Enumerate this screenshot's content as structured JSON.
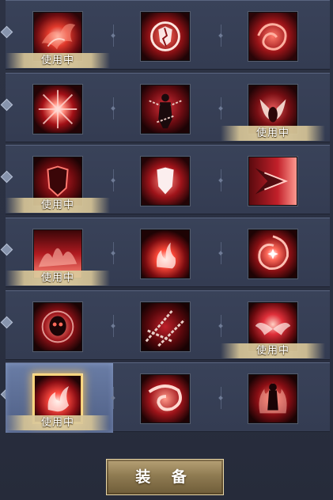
{
  "equip_button": {
    "label": "装 备"
  },
  "badge_text": "使用中",
  "rows": [
    {
      "skills": [
        {
          "name": "flame-burst-skill-icon",
          "in_use": true
        },
        {
          "name": "shattered-shield-skill-icon",
          "in_use": false
        },
        {
          "name": "crimson-swirl-skill-icon",
          "in_use": false
        }
      ]
    },
    {
      "skills": [
        {
          "name": "radiant-explosion-skill-icon",
          "in_use": false
        },
        {
          "name": "chained-figure-skill-icon",
          "in_use": false
        },
        {
          "name": "demon-horns-skill-icon",
          "in_use": true
        }
      ]
    },
    {
      "skills": [
        {
          "name": "blood-shield-skill-icon",
          "in_use": true
        },
        {
          "name": "white-shield-skill-icon",
          "in_use": false
        },
        {
          "name": "dash-streak-skill-icon",
          "in_use": false
        }
      ]
    },
    {
      "skills": [
        {
          "name": "fire-wave-skill-icon",
          "in_use": true
        },
        {
          "name": "blaze-skill-icon",
          "in_use": false
        },
        {
          "name": "vortex-star-skill-icon",
          "in_use": false
        }
      ]
    },
    {
      "skills": [
        {
          "name": "skull-aura-skill-icon",
          "in_use": false
        },
        {
          "name": "iron-chains-skill-icon",
          "in_use": false
        },
        {
          "name": "flame-wings-skill-icon",
          "in_use": true
        }
      ]
    },
    {
      "skills": [
        {
          "name": "phoenix-flame-skill-icon",
          "in_use": true,
          "selected": true
        },
        {
          "name": "whirlwind-skill-icon",
          "in_use": false
        },
        {
          "name": "burning-body-skill-icon",
          "in_use": false
        }
      ]
    }
  ]
}
